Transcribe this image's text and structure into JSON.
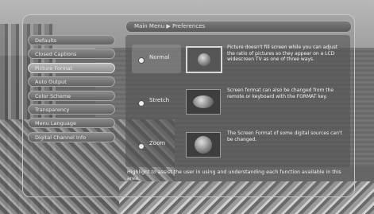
{
  "title": "Main Menu ▶ Preferences",
  "menu": {
    "items": [
      {
        "label": "Defaults"
      },
      {
        "label": "Closed Captions"
      },
      {
        "label": "Picture Format"
      },
      {
        "label": "Auto Output"
      },
      {
        "label": "Color Scheme"
      },
      {
        "label": "Transparency"
      },
      {
        "label": "Menu Language"
      },
      {
        "label": "Digital Channel Info"
      }
    ],
    "active_index": 2
  },
  "options": [
    {
      "label": "Normal",
      "description": "Picture doesn't fill screen while you can adjust the ratio of pictures so they appear on a LCD widescreen TV as one of three ways."
    },
    {
      "label": "Stretch",
      "description": "Screen format can also be changed from the remote or keyboard with the FORMAT key."
    },
    {
      "label": "Zoom",
      "description": "The Screen Format of some digital sources can't be changed."
    }
  ],
  "help_text": "Highlight to assist the user in using and understanding each function available in this area."
}
